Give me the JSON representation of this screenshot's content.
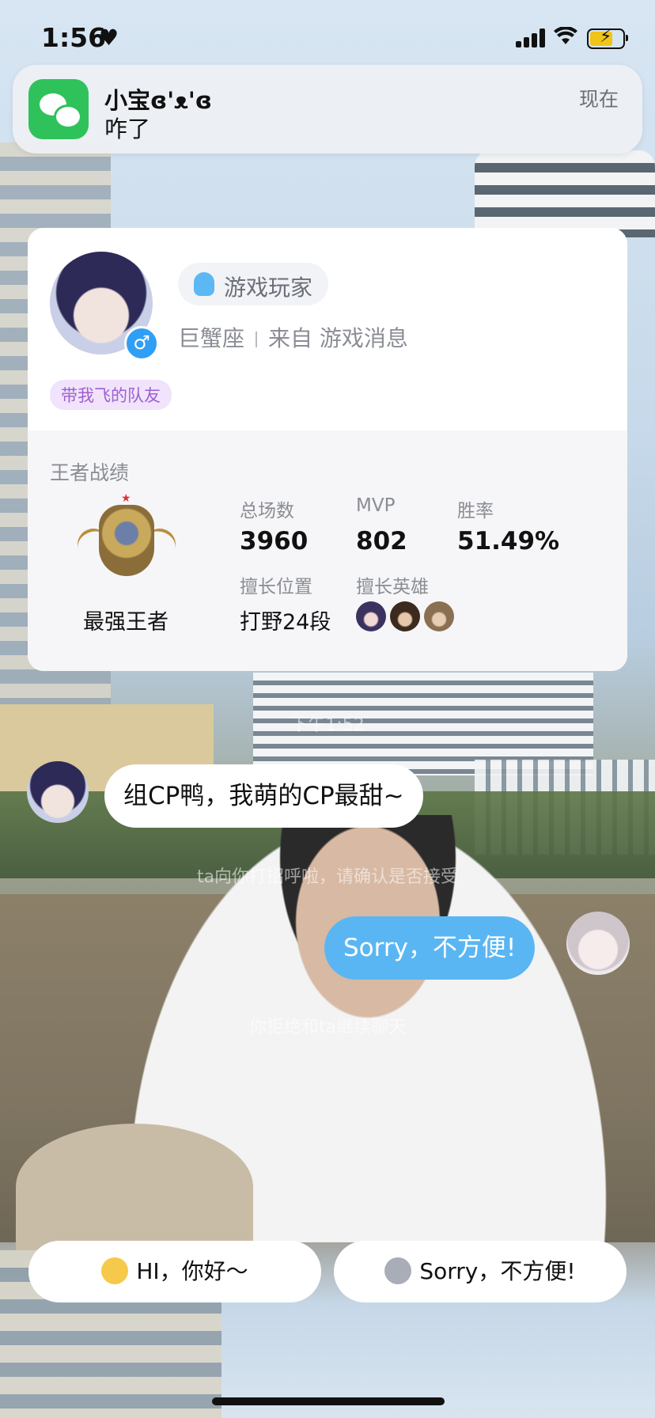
{
  "status_bar": {
    "time": "1:56",
    "heart": "♥",
    "wifi": "📶"
  },
  "notification": {
    "app_icon": "wechat-icon",
    "sender": "小宝ɞ'ᴥ'ɞ",
    "message": "咋了",
    "time": "现在"
  },
  "profile": {
    "player_tag": "游戏玩家",
    "zodiac": "巨蟹座",
    "source": "来自 游戏消息",
    "team_tag": "带我飞的队友",
    "gender_symbol": "♂",
    "accent_color": "#2f9ff5"
  },
  "stats": {
    "section_title": "王者战绩",
    "rank_name": "最强王者",
    "total_label": "总场数",
    "total_value": "3960",
    "mvp_label": "MVP",
    "mvp_value": "802",
    "winrate_label": "胜率",
    "winrate_value": "51.49%",
    "position_label": "擅长位置",
    "position_value": "打野24段",
    "heroes_label": "擅长英雄"
  },
  "chat": {
    "timestamp": "下午1:52",
    "incoming_message": "组CP鸭，我萌的CP最甜~",
    "system_notice_1": "ta向你打招呼啦，请确认是否接受",
    "outgoing_message": "Sorry，不方便!",
    "system_notice_2": "你拒绝和ta继续聊天",
    "bubble_color": "#5ab6f2"
  },
  "actions": {
    "hi_label": "HI，你好～",
    "sorry_label": "Sorry，不方便!"
  }
}
